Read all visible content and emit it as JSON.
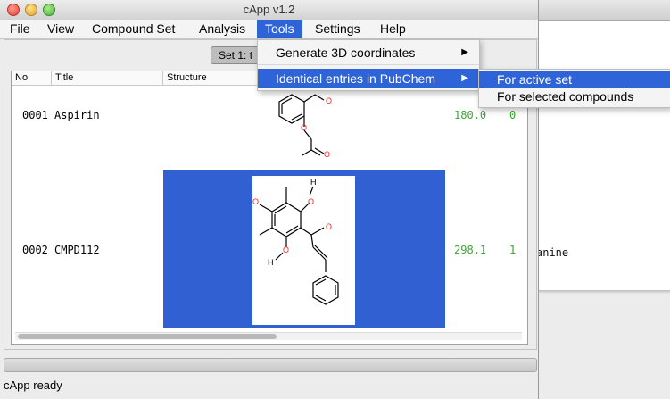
{
  "window": {
    "title": "cApp v1.2"
  },
  "menubar": {
    "items": [
      "File",
      "View",
      "Compound Set",
      "Analysis",
      "Tools",
      "Settings",
      "Help"
    ],
    "active": "Tools"
  },
  "tab": {
    "label": "Set 1: t"
  },
  "table": {
    "columns": [
      "No",
      "Title",
      "Structure"
    ],
    "rows": [
      {
        "no": "0001",
        "title": "Aspirin",
        "value": "180.0",
        "extra": "0"
      },
      {
        "no": "0002",
        "title": "CMPD112",
        "value": "298.1",
        "extra": "1"
      }
    ]
  },
  "tools_menu": {
    "items": [
      {
        "label": "Generate 3D coordinates",
        "has_submenu": true
      },
      {
        "label": "Identical entries in PubChem",
        "has_submenu": true,
        "highlighted": true
      }
    ]
  },
  "pubchem_submenu": {
    "items": [
      {
        "label": "For active set",
        "highlighted": true
      },
      {
        "label": "For selected compounds"
      }
    ]
  },
  "background_window": {
    "text": "anine"
  },
  "status": {
    "text": "cApp ready"
  },
  "colors": {
    "highlight": "#2f64d8",
    "selection": "#3060d2",
    "value_green": "#3aa832",
    "oxygen_red": "#e0302a"
  }
}
